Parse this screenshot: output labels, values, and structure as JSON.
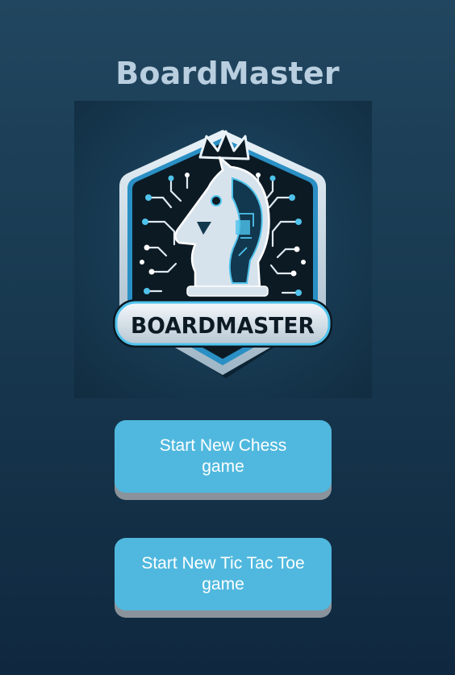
{
  "app": {
    "title": "BoardMaster",
    "logo": {
      "icon": "chess-knight-circuit-badge",
      "wordmark": "BOARDMASTER"
    }
  },
  "buttons": {
    "chess": "Start New Chess game",
    "tictactoe": "Start New Tic Tac Toe game"
  },
  "colors": {
    "background": "#183950",
    "title": "#b9cfe0",
    "button": "#50b8de",
    "button_shadow": "#8a939b",
    "button_text": "#ffffff",
    "accent": "#4fc3ec"
  }
}
